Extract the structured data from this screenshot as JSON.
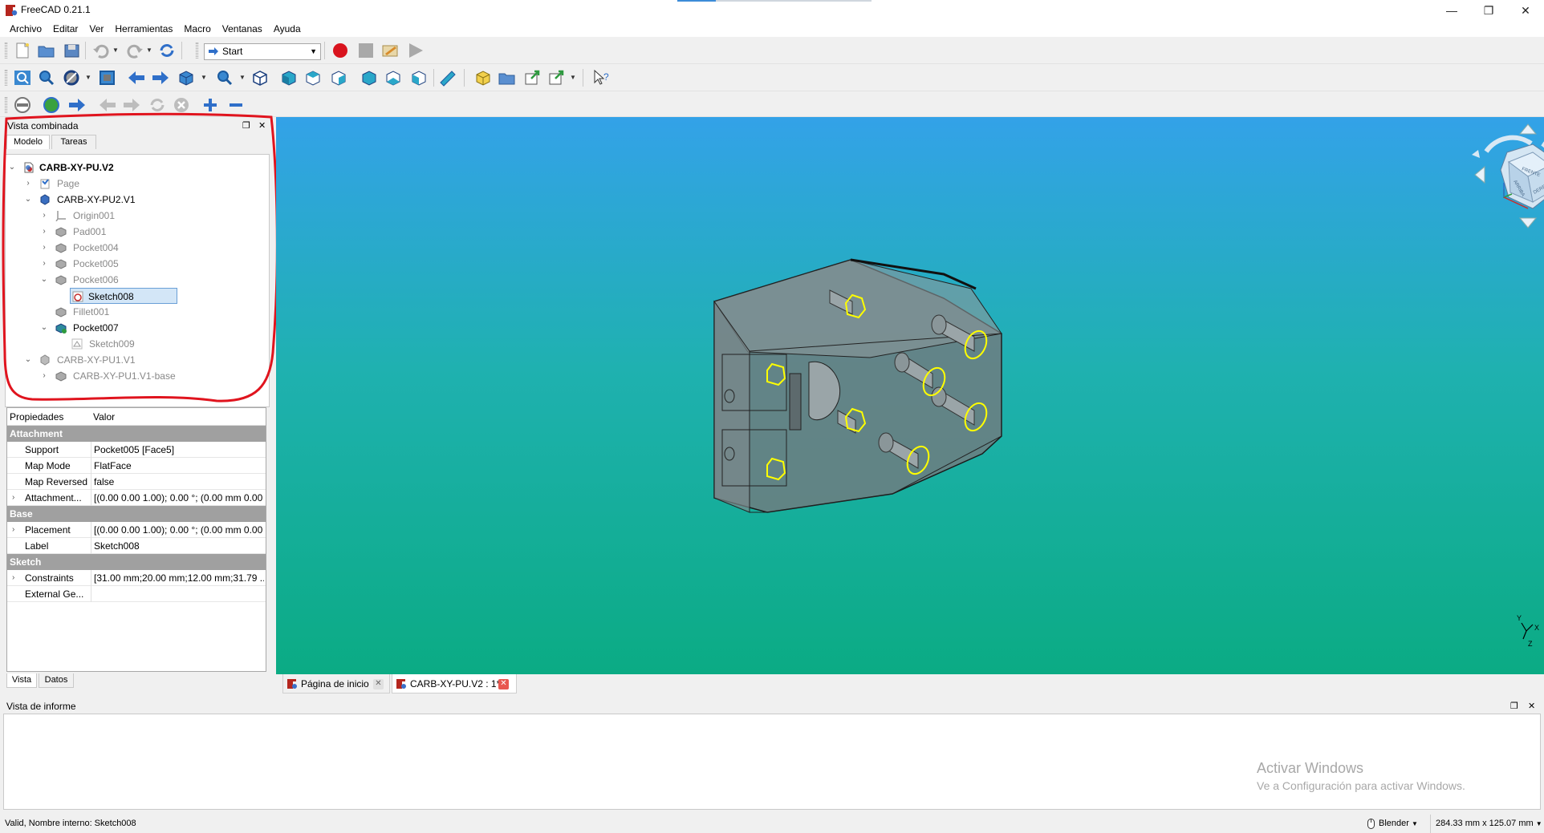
{
  "window": {
    "title": "FreeCAD 0.21.1",
    "minimize": "—",
    "restore": "❐",
    "close": "✕"
  },
  "menu": [
    "Archivo",
    "Editar",
    "Ver",
    "Herramientas",
    "Macro",
    "Ventanas",
    "Ayuda"
  ],
  "toolbar": {
    "workbench": "Start"
  },
  "combo_view": {
    "title": "Vista combinada",
    "tabs": [
      "Modelo",
      "Tareas"
    ]
  },
  "tree": [
    {
      "label": "CARB-XY-PU.V2",
      "icon": "document-icon"
    },
    {
      "label": "Page",
      "icon": "page-icon"
    },
    {
      "label": "CARB-XY-PU2.V1",
      "icon": "body-icon"
    },
    {
      "label": "Origin001",
      "icon": "origin-icon"
    },
    {
      "label": "Pad001",
      "icon": "pad-icon"
    },
    {
      "label": "Pocket004",
      "icon": "pocket-icon"
    },
    {
      "label": "Pocket005",
      "icon": "pocket-icon"
    },
    {
      "label": "Pocket006",
      "icon": "pocket-icon"
    },
    {
      "label": "Sketch008",
      "icon": "sketch-icon"
    },
    {
      "label": "Fillet001",
      "icon": "fillet-icon"
    },
    {
      "label": "Pocket007",
      "icon": "pocket-icon"
    },
    {
      "label": "Sketch009",
      "icon": "sketch-icon"
    },
    {
      "label": "CARB-XY-PU1.V1",
      "icon": "body-icon"
    },
    {
      "label": "CARB-XY-PU1.V1-base",
      "icon": "pad-icon"
    }
  ],
  "properties": {
    "col_property": "Propiedades",
    "col_value": "Valor",
    "groups": {
      "attachment": "Attachment",
      "base": "Base",
      "sketch": "Sketch"
    },
    "rows": {
      "support": {
        "key": "Support",
        "value": "Pocket005 [Face5]"
      },
      "map_mode": {
        "key": "Map Mode",
        "value": "FlatFace"
      },
      "map_reversed": {
        "key": "Map Reversed",
        "value": "false"
      },
      "attachment": {
        "key": "Attachment...",
        "value": "[(0.00 0.00 1.00); 0.00 °; (0.00 mm  0.00 ..."
      },
      "placement": {
        "key": "Placement",
        "value": "[(0.00 0.00 1.00); 0.00 °; (0.00 mm  0.00 ..."
      },
      "label": {
        "key": "Label",
        "value": "Sketch008"
      },
      "constraints": {
        "key": "Constraints",
        "value": "[31.00 mm;20.00 mm;12.00 mm;31.79 ..."
      },
      "external": {
        "key": "External Ge...",
        "value": ""
      }
    },
    "tabs": [
      "Vista",
      "Datos"
    ]
  },
  "viewport": {
    "navcube_faces": [
      "FRENTE",
      "DERECHA",
      "ARRIBA"
    ],
    "axes": [
      "Y",
      "X",
      "Z"
    ]
  },
  "doc_tabs": [
    {
      "label": "Página de inicio"
    },
    {
      "label": "CARB-XY-PU.V2 : 1*"
    }
  ],
  "report": {
    "title": "Vista de informe",
    "watermark_title": "Activar Windows",
    "watermark_sub": "Ve a Configuración para activar Windows."
  },
  "status": {
    "message": "Valid, Nombre interno: Sketch008",
    "nav_style": "Blender",
    "dimensions": "284.33 mm x 125.07 mm"
  },
  "colors": {
    "viewport_top": "#33a2e8",
    "viewport_bottom": "#0bab84",
    "annotation": "#e0141e",
    "selection_highlight": "#ffff00"
  }
}
